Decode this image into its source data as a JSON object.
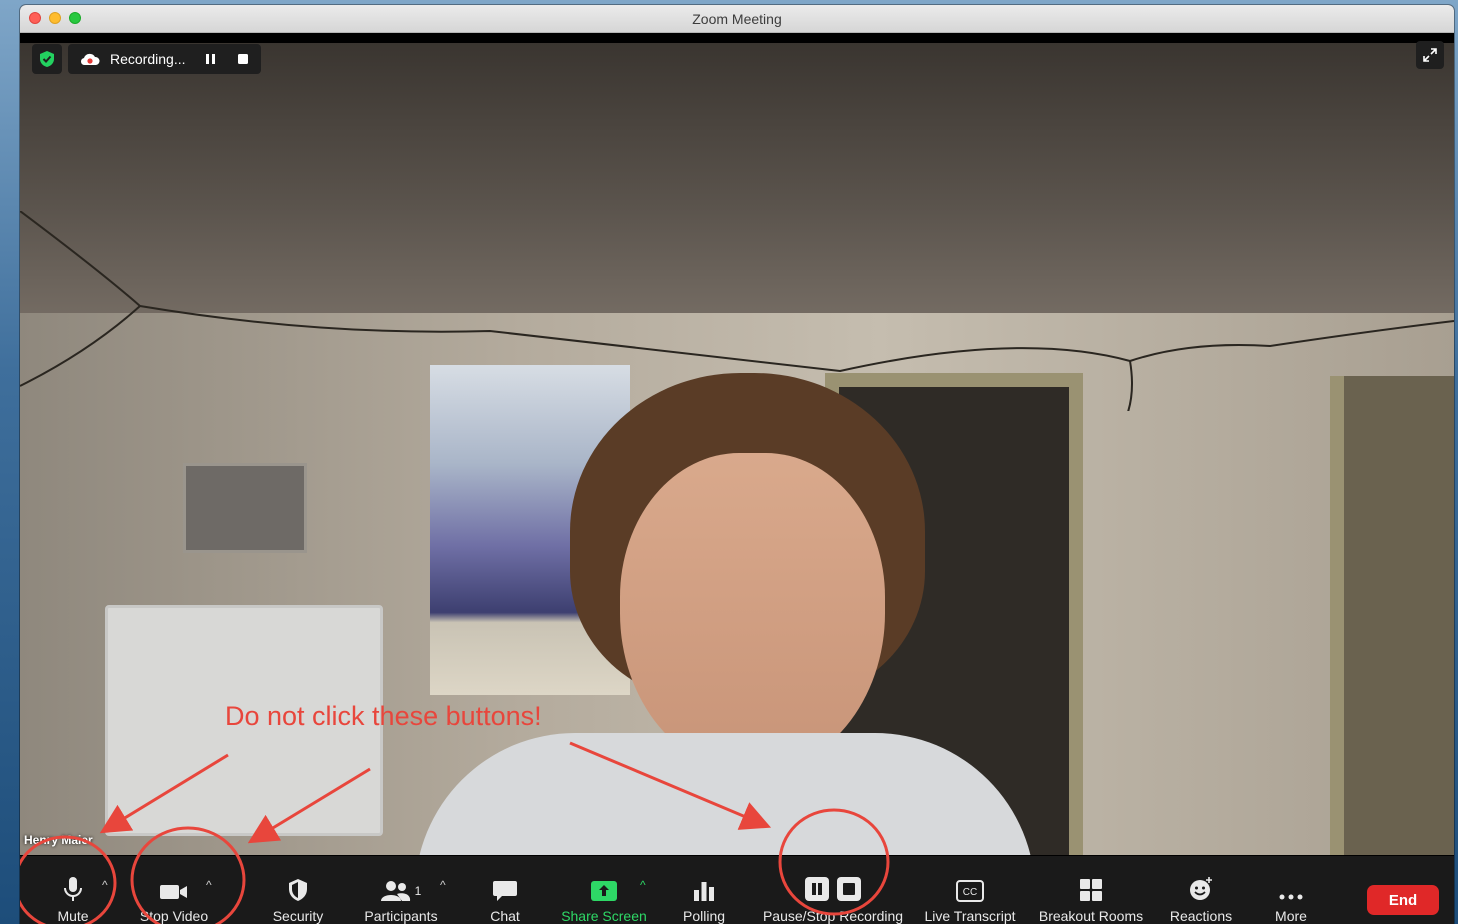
{
  "window": {
    "title": "Zoom Meeting"
  },
  "recording": {
    "status_label": "Recording..."
  },
  "participant": {
    "name": "Henry Maier"
  },
  "toolbar": {
    "mute_label": "Mute",
    "video_label": "Stop Video",
    "security_label": "Security",
    "participants_label": "Participants",
    "participants_count": "1",
    "chat_label": "Chat",
    "share_label": "Share Screen",
    "polling_label": "Polling",
    "recording_label": "Pause/Stop Recording",
    "transcript_label": "Live Transcript",
    "breakout_label": "Breakout Rooms",
    "reactions_label": "Reactions",
    "more_label": "More",
    "end_label": "End",
    "cc_text": "CC"
  },
  "annotation": {
    "text": "Do not click these buttons!",
    "color": "#e8463c"
  },
  "colors": {
    "toolbar_bg": "#1a1a1a",
    "share_green": "#2ed866",
    "end_red": "#e02828"
  },
  "icons": [
    "shield-check-icon",
    "cloud-record-icon",
    "pause-icon",
    "stop-icon",
    "fullscreen-icon",
    "microphone-icon",
    "video-camera-icon",
    "security-shield-icon",
    "participants-icon",
    "chat-bubble-icon",
    "share-screen-icon",
    "polling-icon",
    "closed-caption-icon",
    "breakout-rooms-icon",
    "reactions-icon",
    "more-dots-icon"
  ]
}
